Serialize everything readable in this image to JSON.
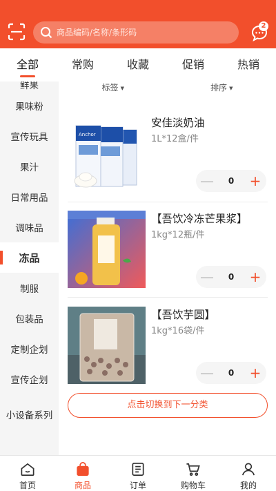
{
  "colors": {
    "accent": "#f24f2c"
  },
  "header": {
    "search_placeholder": "商品编码/名称/条形码",
    "message_badge": "2",
    "icons": [
      "scan-icon",
      "search-icon",
      "message-icon"
    ]
  },
  "tabs": [
    {
      "label": "全部",
      "active": true
    },
    {
      "label": "常购"
    },
    {
      "label": "收藏"
    },
    {
      "label": "促销"
    },
    {
      "label": "热销"
    }
  ],
  "categories": [
    {
      "label": "鲜果"
    },
    {
      "label": "果味粉"
    },
    {
      "label": "宣传玩具"
    },
    {
      "label": "果汁"
    },
    {
      "label": "日常用品"
    },
    {
      "label": "调味品"
    },
    {
      "label": "冻品",
      "active": true
    },
    {
      "label": "制服"
    },
    {
      "label": "包装品"
    },
    {
      "label": "定制企划"
    },
    {
      "label": "宣传企划"
    },
    {
      "label": "小设备系列"
    }
  ],
  "filters": {
    "tag": "标签",
    "sort": "排序"
  },
  "products": [
    {
      "name": "安佳淡奶油",
      "spec": "1L*12盒/件",
      "qty": "0",
      "image_label": "Anchor Whipping Cream"
    },
    {
      "name": "【吾饮冷冻芒果浆】",
      "spec": "1kg*12瓶/件",
      "qty": "0",
      "image_label": "[吾饮冷冻芒果浆]"
    },
    {
      "name": "【吾饮芋圆】",
      "spec": "1kg*16袋/件",
      "qty": "0",
      "image_label": "芋圆"
    }
  ],
  "stepper": {
    "minus": "—",
    "plus": "+"
  },
  "switch_button": "点击切换到下一分类",
  "bottom_nav": [
    {
      "label": "首页",
      "icon": "home-icon"
    },
    {
      "label": "商品",
      "icon": "bag-icon",
      "active": true
    },
    {
      "label": "订单",
      "icon": "order-icon"
    },
    {
      "label": "购物车",
      "icon": "cart-icon"
    },
    {
      "label": "我的",
      "icon": "user-icon"
    }
  ]
}
